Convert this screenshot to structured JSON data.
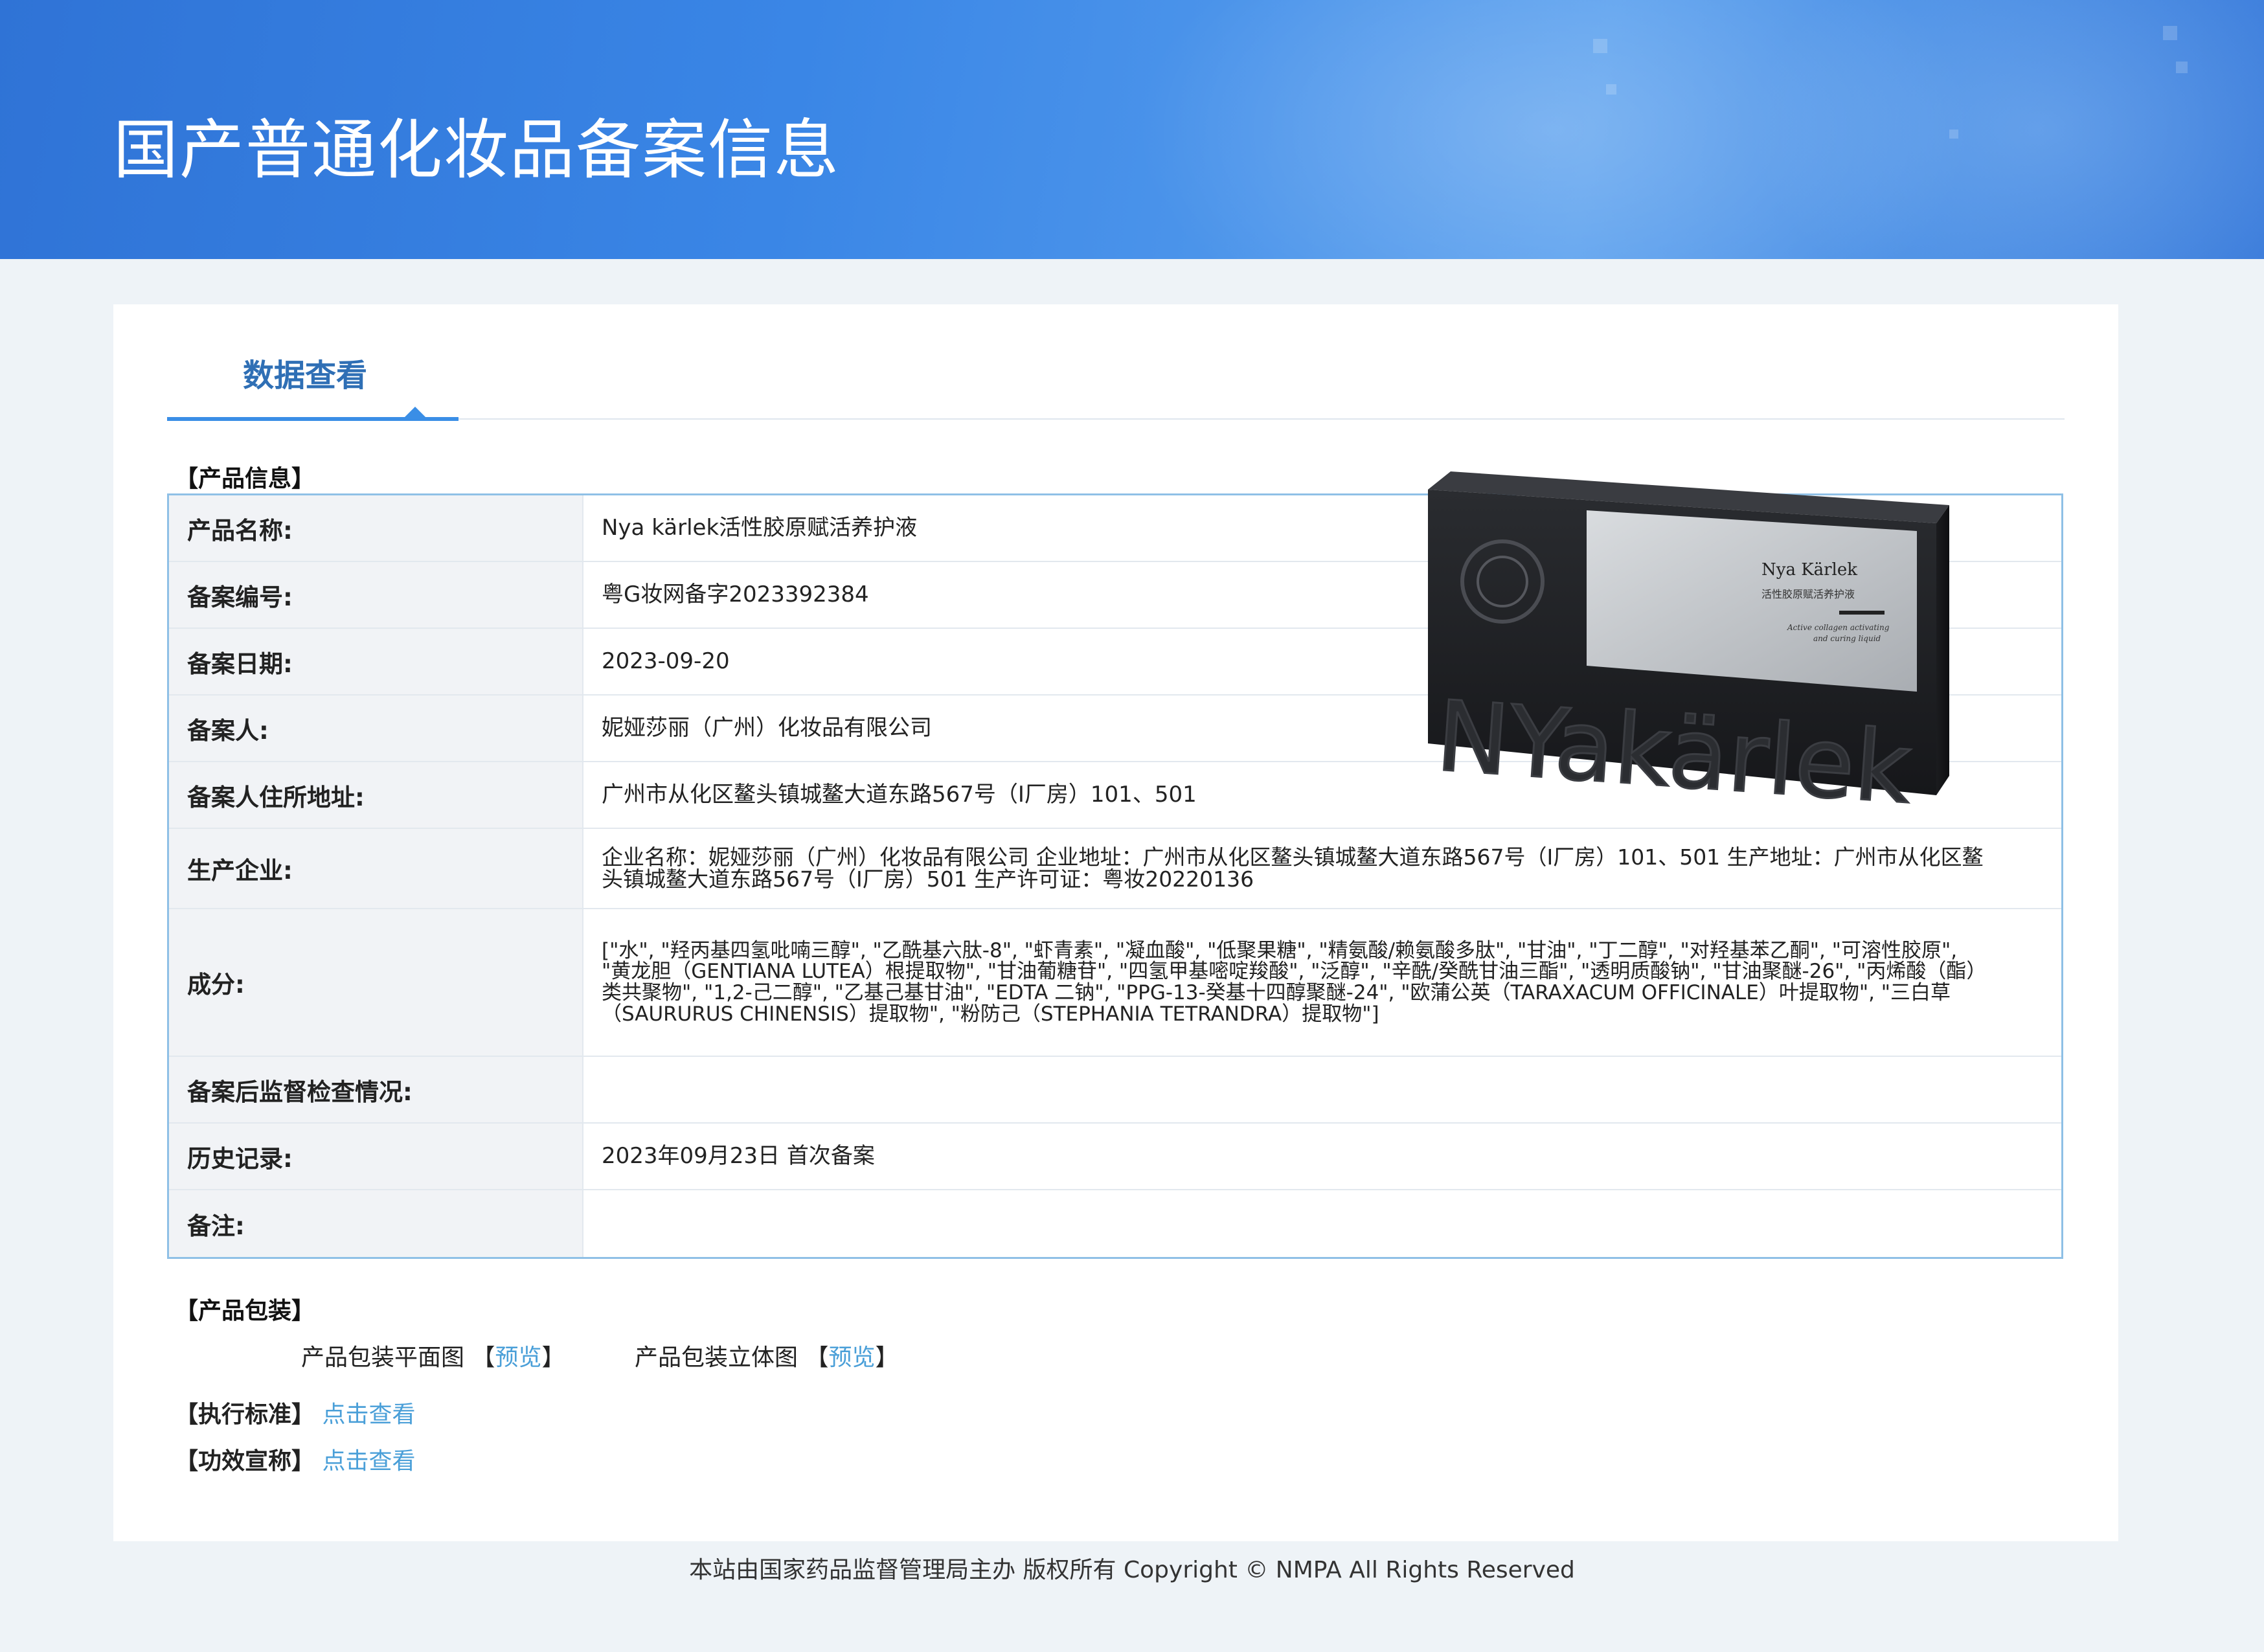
{
  "header": {
    "title": "国产普通化妆品备案信息"
  },
  "tab": {
    "title": "数据查看"
  },
  "sections": {
    "product_info": "【产品信息】",
    "packaging": "【产品包装】",
    "standard": "【执行标准】",
    "claims": "【功效宣称】"
  },
  "rows": [
    {
      "label": "产品名称:",
      "value": "Nya kärlek活性胶原赋活养护液"
    },
    {
      "label": "备案编号:",
      "value": "粤G妆网备字2023392384"
    },
    {
      "label": "备案日期:",
      "value": "2023-09-20"
    },
    {
      "label": "备案人:",
      "value": "妮娅莎丽（广州）化妆品有限公司"
    },
    {
      "label": "备案人住所地址:",
      "value": "广州市从化区鳌头镇城鳌大道东路567号（I厂房）101、501"
    },
    {
      "label": "生产企业:",
      "value": "企业名称：妮娅莎丽（广州）化妆品有限公司 企业地址：广州市从化区鳌头镇城鳌大道东路567号（I厂房）101、501 生产地址：广州市从化区鳌头镇城鳌大道东路567号（I厂房）501 生产许可证：粤妆20220136"
    },
    {
      "label": "成分:",
      "value": "[\"水\", \"羟丙基四氢吡喃三醇\", \"乙酰基六肽-8\", \"虾青素\", \"凝血酸\", \"低聚果糖\", \"精氨酸/赖氨酸多肽\", \"甘油\", \"丁二醇\", \"对羟基苯乙酮\", \"可溶性胶原\", \"黄龙胆（GENTIANA LUTEA）根提取物\", \"甘油葡糖苷\", \"四氢甲基嘧啶羧酸\", \"泛醇\", \"辛酰/癸酰甘油三酯\", \"透明质酸钠\", \"甘油聚醚-26\", \"丙烯酸（酯）类共聚物\", \"1,2-己二醇\", \"乙基己基甘油\", \"EDTA 二钠\", \"PPG-13-癸基十四醇聚醚-24\", \"欧蒲公英（TARAXACUM OFFICINALE）叶提取物\", \"三白草（SAURURUS CHINENSIS）提取物\", \"粉防己（STEPHANIA TETRANDRA）提取物\"]"
    },
    {
      "label": "备案后监督检查情况:",
      "value": ""
    },
    {
      "label": "历史记录:",
      "value": "2023年09月23日 首次备案"
    },
    {
      "label": "备注:",
      "value": ""
    }
  ],
  "product_image": {
    "brand": "Nya Kärlek",
    "subtitle": "活性胶原赋活养护液",
    "tagline_1": "Active collagen activating",
    "tagline_2": "and curing liquid",
    "embossed": "NYakärlek"
  },
  "packaging": {
    "flat_label": "产品包装平面图",
    "flat_link": "预览",
    "solid_label": "产品包装立体图",
    "solid_link": "预览",
    "open": "【",
    "close": "】"
  },
  "links": {
    "standard": "点击查看",
    "claims": "点击查看"
  },
  "footer": {
    "text": "本站由国家药品监督管理局主办 版权所有 Copyright © NMPA All Rights Reserved"
  }
}
